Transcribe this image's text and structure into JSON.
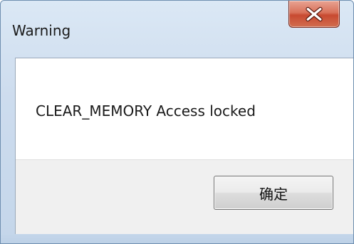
{
  "window": {
    "title": "Warning",
    "message": "CLEAR_MEMORY Access locked",
    "ok_label": "确定",
    "close_icon": "close-x-icon"
  },
  "colors": {
    "frame": "#cddcee",
    "close_button": "#c84a31",
    "content_bg": "#ffffff",
    "footer_bg": "#f0f0f0"
  }
}
